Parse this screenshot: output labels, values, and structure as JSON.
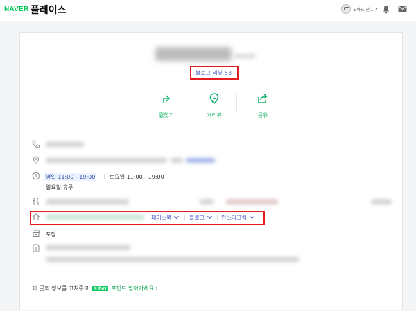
{
  "header": {
    "logo": "NAVER",
    "brand": "플레이스",
    "user_name": "노마드 선..."
  },
  "place": {
    "review_link": "블로그 리뷰 53"
  },
  "actions": [
    {
      "label": "길찾기"
    },
    {
      "label": "거리뷰"
    },
    {
      "label": "공유"
    }
  ],
  "hours": {
    "weekday": "평일 11:00 - 19:00",
    "saturday": "토요일 11:00 - 19:00",
    "sunday": "일요일 휴무"
  },
  "sns_links": {
    "facebook": "페이스북",
    "blog": "블로그",
    "instagram": "인스타그램"
  },
  "service": "포장",
  "footer": {
    "prefix": "이 곳의 정보를 고쳐주고",
    "npay": "N Pay",
    "link": "포인트 받아가세요"
  },
  "colors": {
    "naver_green": "#03c75a",
    "link_blue": "#4a5ec9",
    "highlight_red": "#e21d22"
  }
}
